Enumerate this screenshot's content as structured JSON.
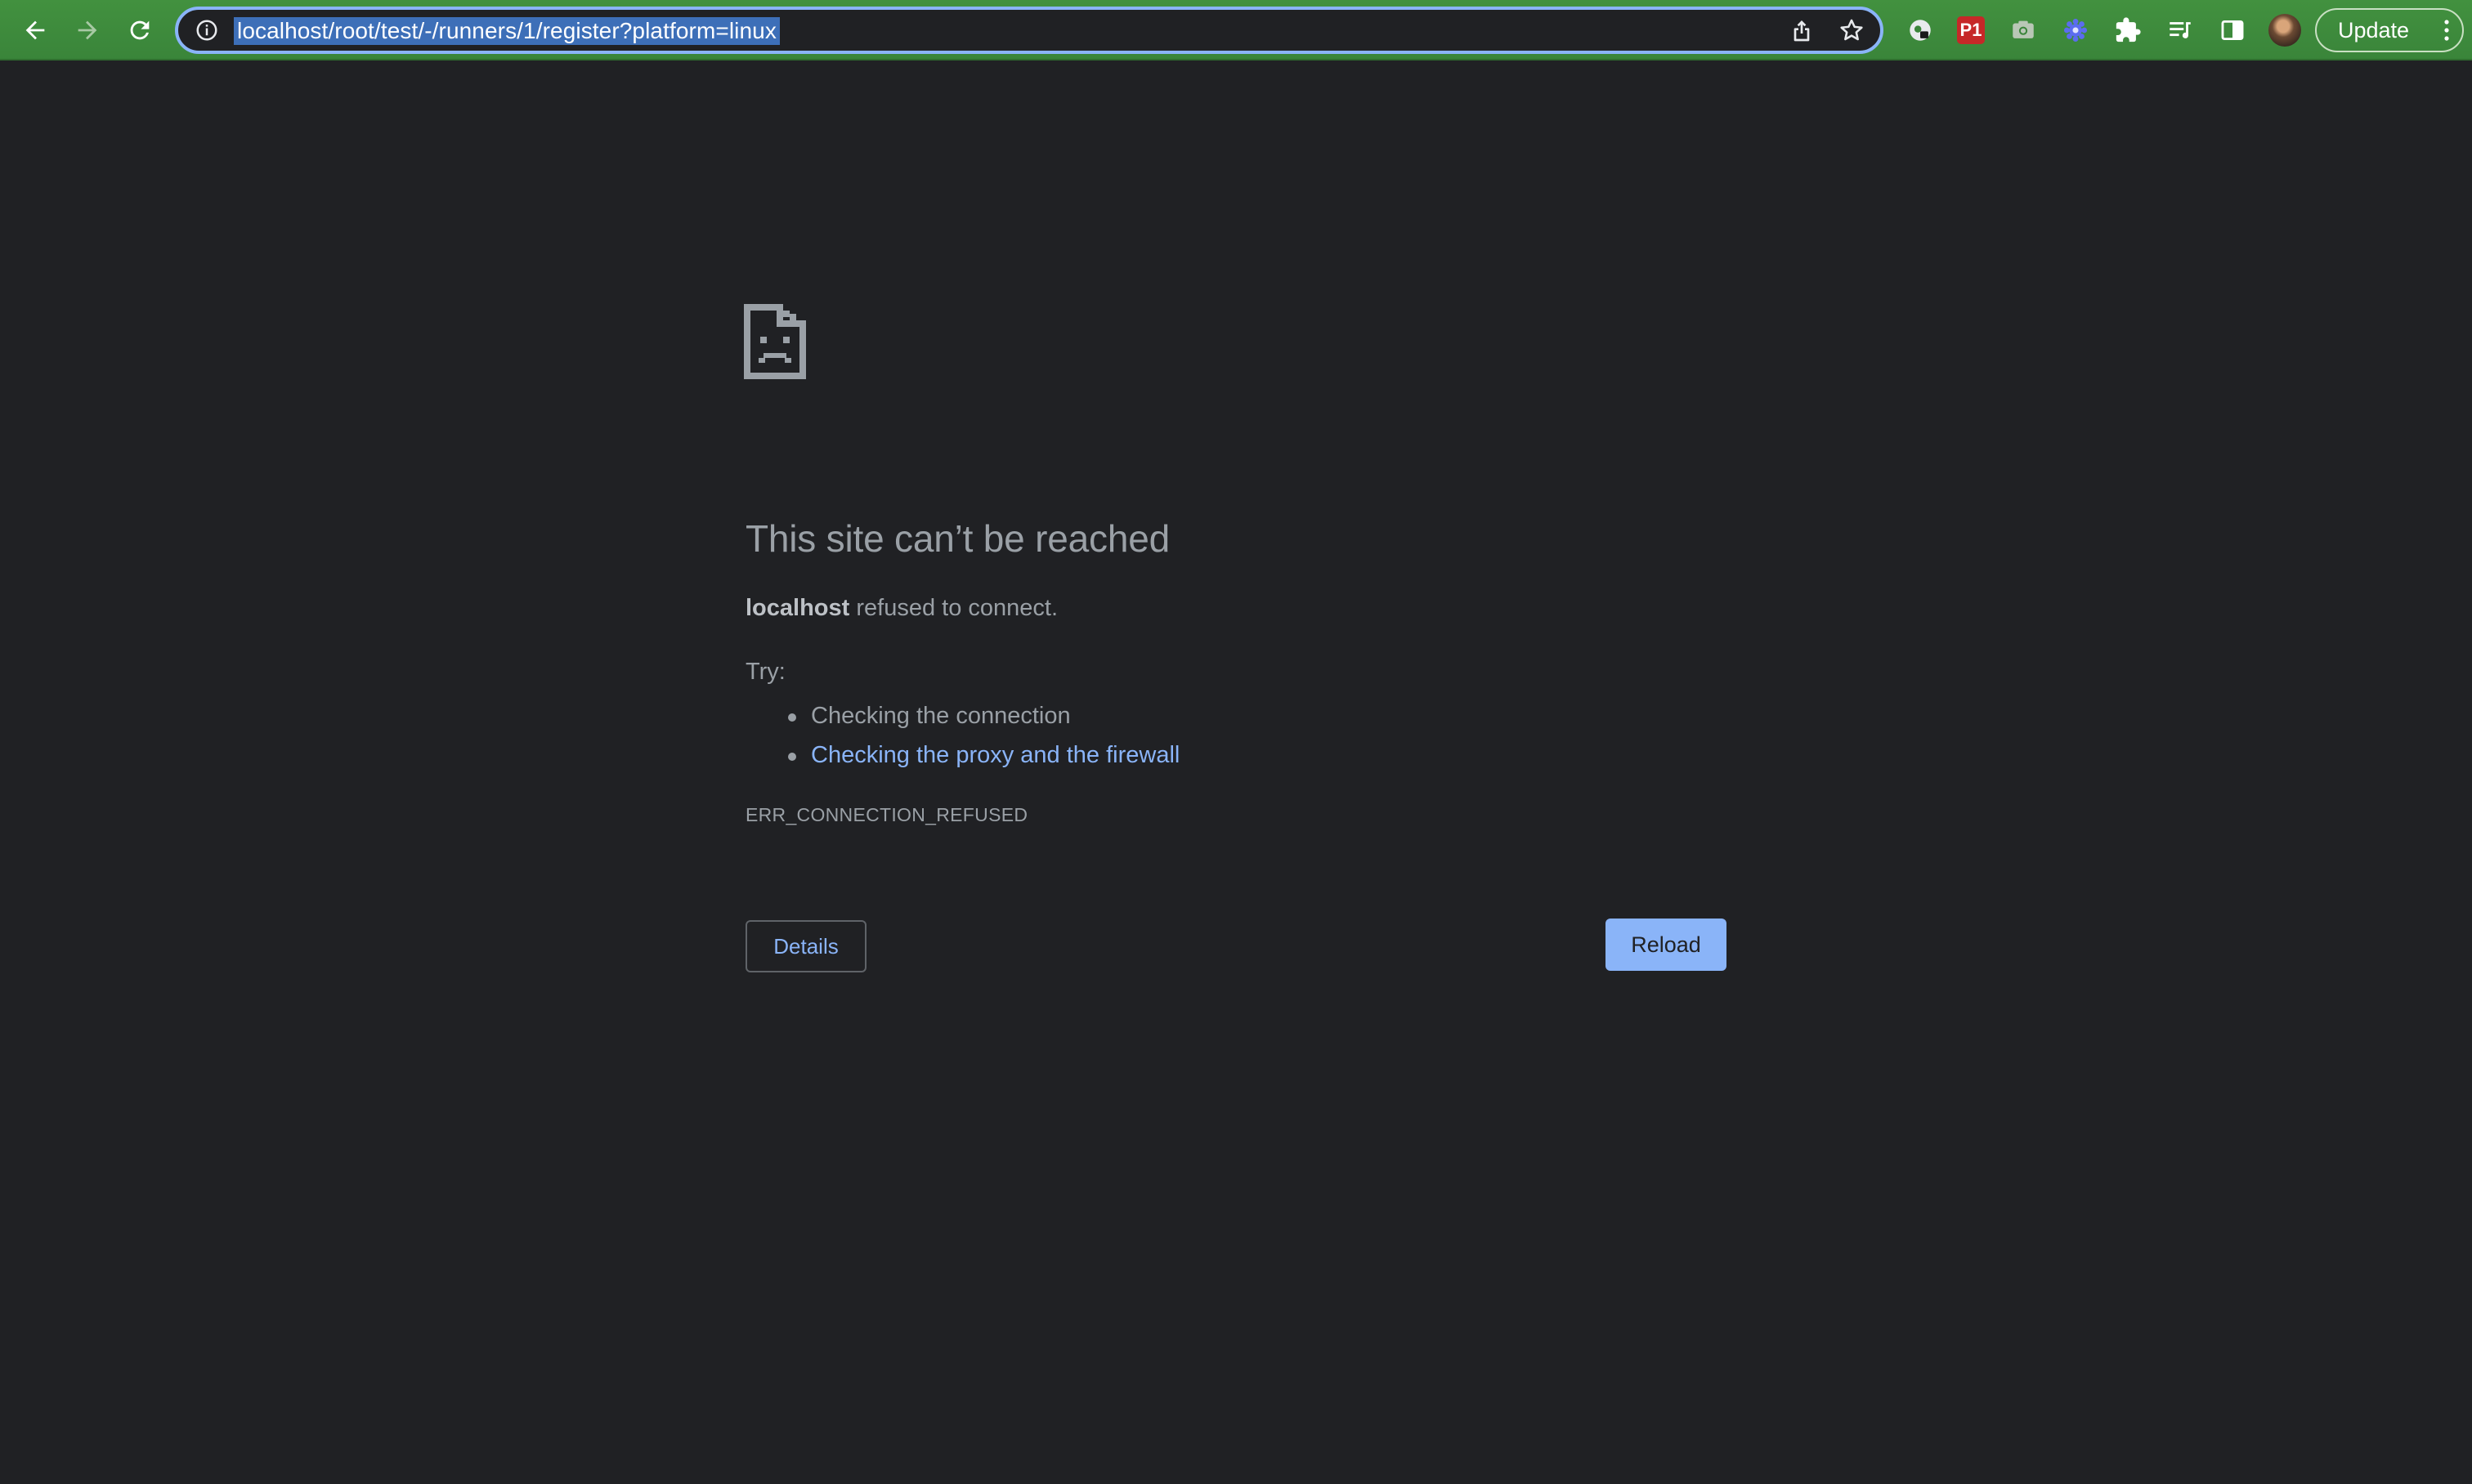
{
  "browser": {
    "url": "localhost/root/test/-/runners/1/register?platform=linux",
    "extensions": [
      {
        "name": "password-manager-icon"
      },
      {
        "name": "p1-extension-icon",
        "label": "P1"
      },
      {
        "name": "camera-icon"
      },
      {
        "name": "gear-flower-icon"
      },
      {
        "name": "puzzle-icon"
      },
      {
        "name": "reading-list-icon"
      },
      {
        "name": "side-panel-icon"
      },
      {
        "name": "avatar"
      }
    ],
    "update_label": "Update",
    "accent_color": "#8ab4f8",
    "toolbar_color": "#3c8a3c"
  },
  "error_page": {
    "title": "This site can’t be reached",
    "host": "localhost",
    "summary_suffix": " refused to connect.",
    "try_label": "Try:",
    "suggestions": [
      {
        "text": "Checking the connection",
        "link": false
      },
      {
        "text": "Checking the proxy and the firewall",
        "link": true
      }
    ],
    "error_code": "ERR_CONNECTION_REFUSED",
    "details_label": "Details",
    "reload_label": "Reload"
  }
}
